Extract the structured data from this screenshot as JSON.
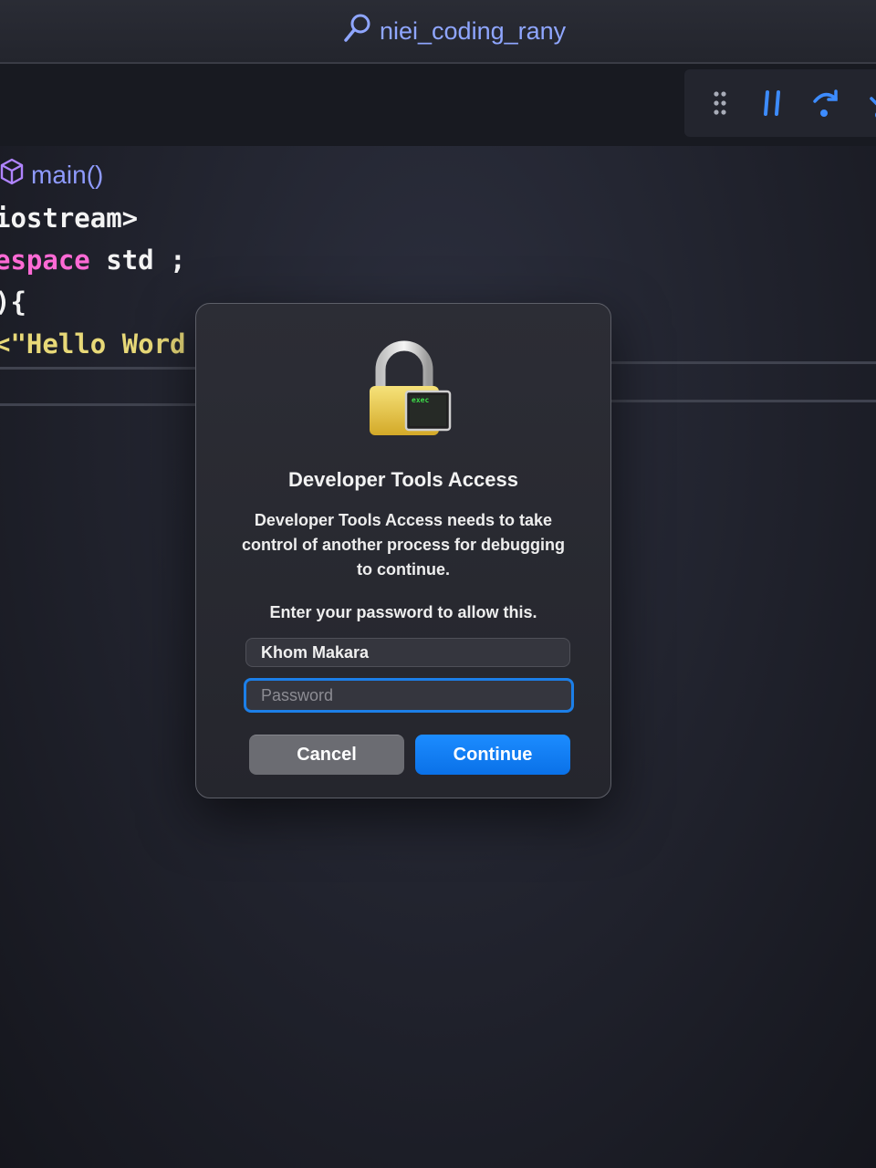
{
  "title_bar": {
    "title": "niei_coding_rany",
    "icon": "search-icon"
  },
  "debug_toolbar": {
    "buttons": [
      {
        "icon": "drag-handle-icon"
      },
      {
        "icon": "pause-icon"
      },
      {
        "icon": "step-over-icon"
      },
      {
        "icon": "step-into-icon"
      }
    ]
  },
  "editor": {
    "breadcrumb": {
      "icon": "cube-icon",
      "label": "main()"
    },
    "lines": [
      {
        "text": "iostream>"
      },
      {
        "keyword": "espace",
        "rest": " std ;"
      },
      {
        "text": "){"
      },
      {
        "string": "<\"Hello Word"
      }
    ]
  },
  "dialog": {
    "icon": "lock-icon",
    "badge_text": "exec",
    "title": "Developer Tools Access",
    "message": "Developer Tools Access needs to take control of another process for debugging to continue.",
    "prompt": "Enter your password to allow this.",
    "username_value": "Khom Makara",
    "password_placeholder": "Password",
    "cancel_label": "Cancel",
    "continue_label": "Continue"
  },
  "colors": {
    "accent": "#0a71e8",
    "keyword": "#ff6ad5",
    "string": "#e8d978",
    "breadcrumb": "#8f9bff"
  }
}
